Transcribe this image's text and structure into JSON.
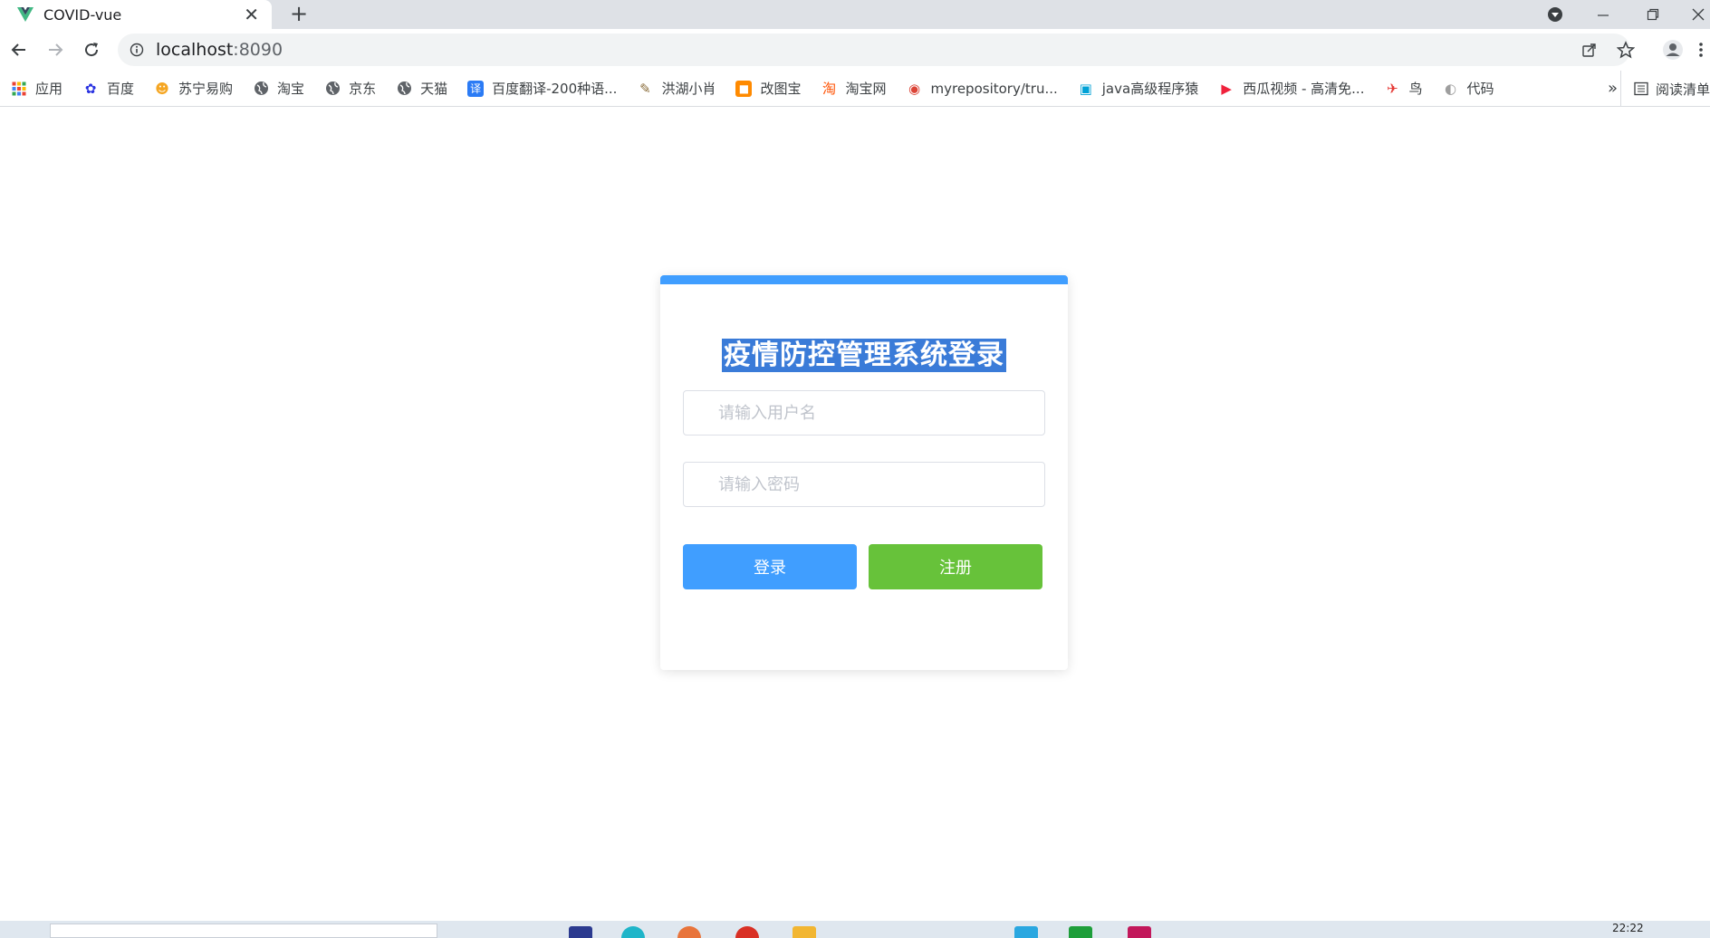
{
  "browser": {
    "tab_title": "COVID-vue",
    "url_host": "localhost",
    "url_port": ":8090"
  },
  "bookmarks": [
    {
      "label": "应用",
      "icon": "apps-grid-icon",
      "color": "#4285f4"
    },
    {
      "label": "百度",
      "icon": "baidu-paw-icon",
      "color": "#2932e1"
    },
    {
      "label": "苏宁易购",
      "icon": "suning-icon",
      "color": "#f5a623"
    },
    {
      "label": "淘宝",
      "icon": "globe-icon",
      "color": "#5f6368"
    },
    {
      "label": "京东",
      "icon": "globe-icon",
      "color": "#5f6368"
    },
    {
      "label": "天猫",
      "icon": "globe-icon",
      "color": "#5f6368"
    },
    {
      "label": "百度翻译-200种语...",
      "icon": "translate-icon",
      "color": "#2b7bf5"
    },
    {
      "label": "洪湖小肖",
      "icon": "bird-icon",
      "color": "#8a6d3b"
    },
    {
      "label": "改图宝",
      "icon": "gaitubao-icon",
      "color": "#ff8a00"
    },
    {
      "label": "淘宝网",
      "icon": "taobao-icon",
      "color": "#ff5000"
    },
    {
      "label": "myrepository/tru...",
      "icon": "chrome-icon",
      "color": "#db4437"
    },
    {
      "label": "java高级程序猿",
      "icon": "bilibili-icon",
      "color": "#00a1d6"
    },
    {
      "label": "西瓜视频 - 高清免...",
      "icon": "xigua-icon",
      "color": "#f0223c"
    },
    {
      "label": "鸟",
      "icon": "bird-red-icon",
      "color": "#e53935"
    },
    {
      "label": "代码",
      "icon": "code-icon",
      "color": "#9e9e9e"
    }
  ],
  "bookmarks_more": "»",
  "reading_list_label": "阅读清单",
  "login": {
    "title": "疫情防控管理系统登录",
    "username_placeholder": "请输入用户名",
    "password_placeholder": "请输入密码",
    "login_label": "登录",
    "register_label": "注册"
  },
  "taskbar": {
    "clock": "22:22"
  },
  "colors": {
    "primary": "#409eff",
    "success": "#67c23a",
    "selection": "#3a7bd8"
  }
}
